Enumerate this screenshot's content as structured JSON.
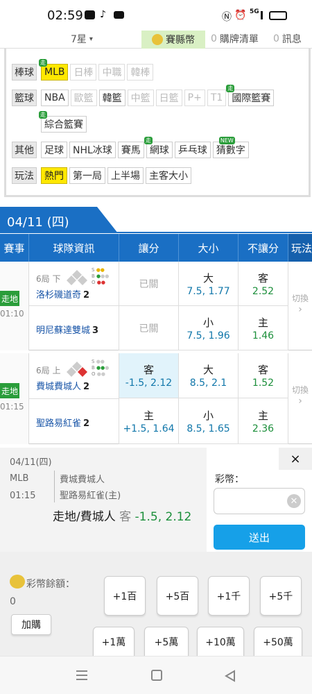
{
  "status_bar": {
    "time": "02:59",
    "signal": "5G"
  },
  "top_nav": {
    "sport_select": "7星",
    "coin_label": "賽縣幣",
    "cart_count": "0",
    "cart_label": "購牌清單",
    "msg_count": "0",
    "msg_label": "訊息"
  },
  "filters": {
    "baseball": {
      "label": "棒球",
      "items": [
        {
          "text": "MLB",
          "state": "on",
          "tag": "走"
        },
        {
          "text": "日棒",
          "state": "dis"
        },
        {
          "text": "中職",
          "state": "dis"
        },
        {
          "text": "韓棒",
          "state": "dis"
        }
      ]
    },
    "basketball": {
      "label": "籃球",
      "items": [
        {
          "text": "NBA",
          "state": "normal"
        },
        {
          "text": "歐籃",
          "state": "dis"
        },
        {
          "text": "韓籃",
          "state": "normal"
        },
        {
          "text": "中籃",
          "state": "dis"
        },
        {
          "text": "日籃",
          "state": "dis"
        },
        {
          "text": "P+",
          "state": "dis"
        },
        {
          "text": "T1",
          "state": "dis"
        },
        {
          "text": "國際籃賽",
          "state": "normal",
          "tag": "走"
        },
        {
          "text": "綜合籃賽",
          "state": "normal",
          "tag": "走"
        }
      ]
    },
    "others": {
      "label": "其他",
      "items": [
        {
          "text": "足球",
          "state": "normal"
        },
        {
          "text": "NHL冰球",
          "state": "normal"
        },
        {
          "text": "賽馬",
          "state": "normal"
        },
        {
          "text": "網球",
          "state": "normal",
          "tag": "走"
        },
        {
          "text": "乒乓球",
          "state": "normal"
        },
        {
          "text": "猜數字",
          "state": "normal",
          "tag": "NEW"
        }
      ]
    },
    "play": {
      "label": "玩法",
      "items": [
        {
          "text": "熱門",
          "state": "on"
        },
        {
          "text": "第一局",
          "state": "normal"
        },
        {
          "text": "上半場",
          "state": "normal"
        },
        {
          "text": "主客大小",
          "state": "normal"
        }
      ]
    }
  },
  "date_header": "04/11 (四)",
  "columns": {
    "event": "賽事",
    "team_info": "球隊資訊",
    "handicap": "讓分",
    "total": "大小",
    "moneyline": "不讓分",
    "play": "玩法"
  },
  "games": [
    {
      "live": "走地",
      "time": "01:10",
      "inning": "6局 下",
      "away_team": "洛杉磯道奇",
      "away_score": "2",
      "home_team": "明尼蘇達雙城",
      "home_score": "3",
      "away_handicap": "已關",
      "home_handicap": "已關",
      "away_total_label": "大",
      "away_total_odds": "7.5, 1.77",
      "home_total_label": "小",
      "home_total_odds": "7.5, 1.96",
      "away_ml_label": "客",
      "away_ml_odds": "2.52",
      "home_ml_label": "主",
      "home_ml_odds": "1.46",
      "switch": "切換",
      "bso": {
        "S": "S",
        "B": "B",
        "O": "O"
      }
    },
    {
      "live": "走地",
      "time": "01:15",
      "inning": "6局 上",
      "away_team": "費城費城人",
      "away_score": "2",
      "home_team": "聖路易紅雀",
      "home_score": "2",
      "away_hc_label": "客",
      "away_hc_odds": "-1.5, 2.12",
      "home_hc_label": "主",
      "home_hc_odds": "+1.5, 1.64",
      "away_total_label": "大",
      "away_total_odds": "8.5, 2.1",
      "home_total_label": "小",
      "home_total_odds": "8.5, 1.65",
      "away_ml_label": "客",
      "away_ml_odds": "1.52",
      "home_ml_label": "主",
      "home_ml_odds": "2.36",
      "switch": "切換",
      "bso": {
        "S": "S",
        "B": "B",
        "O": "O"
      }
    }
  ],
  "bet_slip": {
    "date": "04/11(四)",
    "league": "MLB",
    "time": "01:15",
    "team1": "費城費城人",
    "team2": "聖路易紅雀(主)",
    "selection": "走地/費城人",
    "sel_side": "客",
    "sel_odds": "-1.5, 2.12",
    "stake_label": "彩幣：",
    "stake_placeholder": "",
    "submit": "送出",
    "close": "×",
    "balance_label": "彩幣餘額：",
    "balance": "0",
    "topup": "加購",
    "chips_row1": [
      "+1百",
      "+5百",
      "+1千",
      "+5千"
    ],
    "chips_row2": [
      "+1萬",
      "+5萬",
      "+10萬",
      "+50萬"
    ]
  }
}
